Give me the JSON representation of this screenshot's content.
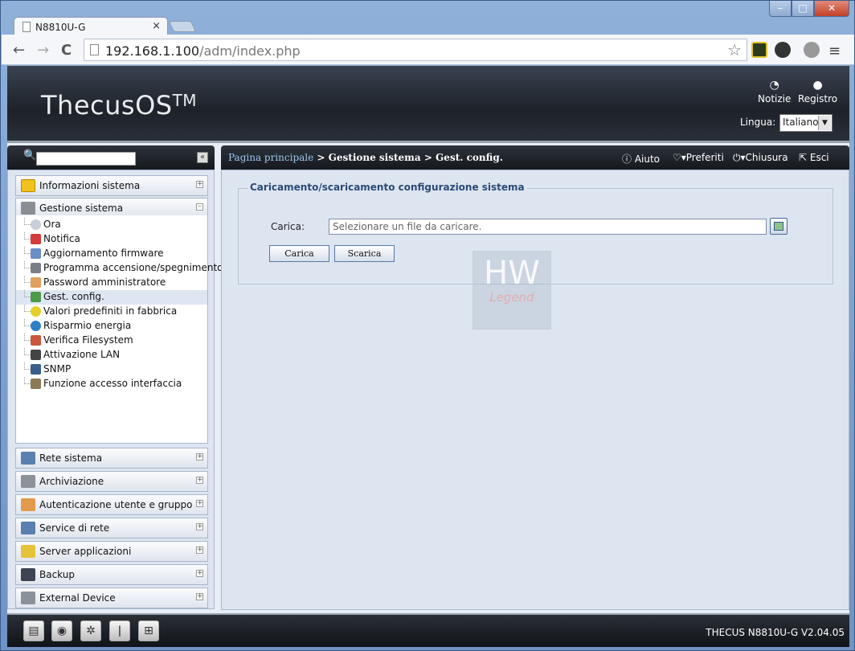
{
  "browser": {
    "tab_title": "N8810U-G",
    "tab_close": "×",
    "url_host": "192.168.1.100",
    "url_path": "/adm/index.php",
    "nav_back": "←",
    "nav_forward": "→",
    "nav_reload": "C",
    "star": "☆",
    "win_min": "–",
    "win_max": "□",
    "win_close": "✕"
  },
  "header": {
    "logo": "ThecusOS",
    "logo_tm": "TM",
    "news_label": "Notizie",
    "log_label": "Registro",
    "lang_label": "Lingua:",
    "lang_value": "Italiano"
  },
  "search": {
    "placeholder": "",
    "collapse": "«"
  },
  "breadcrumb": {
    "home": "Pagina principale",
    "path": " > Gestione sistema > Gest. config."
  },
  "topbar": {
    "help": "Aiuto",
    "favorites": "Preferiti",
    "shutdown": "Chiusura",
    "logout": "Esci"
  },
  "sidebar": {
    "top_sections": [
      {
        "label": "Informazioni sistema",
        "toggle": "+"
      },
      {
        "label": "Gestione sistema",
        "toggle": "–"
      }
    ],
    "items": [
      {
        "label": "Ora"
      },
      {
        "label": "Notifica"
      },
      {
        "label": "Aggiornamento firmware"
      },
      {
        "label": "Programma accensione/spegnimento"
      },
      {
        "label": "Password amministratore"
      },
      {
        "label": "Gest. config."
      },
      {
        "label": "Valori predefiniti in fabbrica"
      },
      {
        "label": "Risparmio energia"
      },
      {
        "label": "Verifica Filesystem"
      },
      {
        "label": "Attivazione LAN"
      },
      {
        "label": "SNMP"
      },
      {
        "label": "Funzione accesso interfaccia"
      }
    ],
    "bottom_sections": [
      {
        "label": "Rete sistema",
        "toggle": "+"
      },
      {
        "label": "Archiviazione",
        "toggle": "+"
      },
      {
        "label": "Autenticazione utente e gruppo",
        "toggle": "+"
      },
      {
        "label": "Service di rete",
        "toggle": "+"
      },
      {
        "label": "Server applicazioni",
        "toggle": "+"
      },
      {
        "label": "Backup",
        "toggle": "+"
      },
      {
        "label": "External Device",
        "toggle": "+"
      }
    ]
  },
  "main": {
    "legend": "Caricamento/scaricamento configurazione sistema",
    "field_label": "Carica:",
    "file_placeholder": "Selezionare un file da caricare.",
    "upload_button": "Carica",
    "download_button": "Scarica"
  },
  "watermark": {
    "mark": "HW",
    "text": "Legend"
  },
  "footer": {
    "version": "THECUS N8810U-G V2.04.05"
  }
}
